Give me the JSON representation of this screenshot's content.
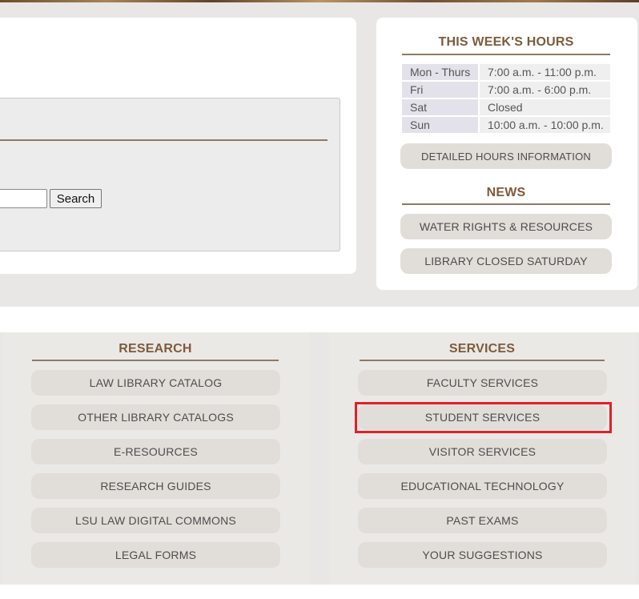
{
  "search": {
    "button_label": "Search",
    "input_value": ""
  },
  "hours": {
    "title": "THIS WEEK'S HOURS",
    "rows": [
      {
        "day": "Mon - Thurs",
        "time": "7:00 a.m. - 11:00 p.m."
      },
      {
        "day": "Fri",
        "time": "7:00 a.m. - 6:00 p.m."
      },
      {
        "day": "Sat",
        "time": "Closed"
      },
      {
        "day": "Sun",
        "time": "10:00 a.m. - 10:00 p.m."
      }
    ],
    "detail_button": "DETAILED HOURS INFORMATION"
  },
  "news": {
    "title": "NEWS",
    "items": [
      "WATER RIGHTS & RESOURCES",
      "LIBRARY CLOSED SATURDAY"
    ]
  },
  "research": {
    "title": "RESEARCH",
    "items": [
      "LAW LIBRARY CATALOG",
      "OTHER LIBRARY CATALOGS",
      "E-RESOURCES",
      "RESEARCH GUIDES",
      "LSU LAW DIGITAL COMMONS",
      "LEGAL FORMS"
    ]
  },
  "services": {
    "title": "SERVICES",
    "items": [
      "FACULTY SERVICES",
      "STUDENT SERVICES",
      "VISITOR SERVICES",
      "EDUCATIONAL TECHNOLOGY",
      "PAST EXAMS",
      "YOUR SUGGESTIONS"
    ]
  },
  "colors": {
    "heading": "#7d5b3a",
    "pill": "#e1ded9",
    "highlight": "#e0202a"
  }
}
